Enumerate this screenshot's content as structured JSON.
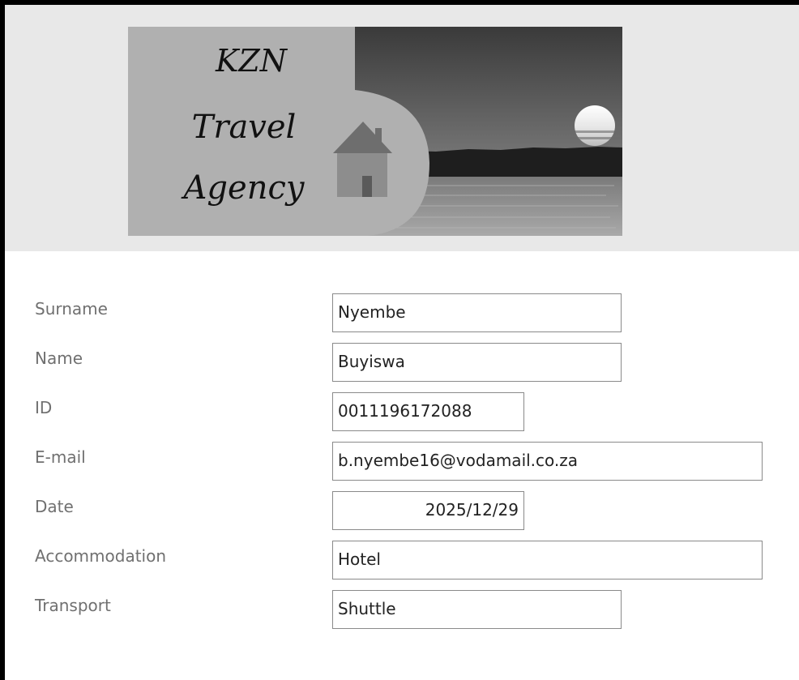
{
  "logo": {
    "name": "KZN Travel Agency",
    "lines": [
      "KZN",
      "Travel",
      "Agency"
    ],
    "icons": [
      "house-icon",
      "sunset-scene-icon"
    ]
  },
  "form": {
    "fields": [
      {
        "key": "surname",
        "label": "Surname",
        "value": "Nyembe"
      },
      {
        "key": "name",
        "label": "Name",
        "value": "Buyiswa"
      },
      {
        "key": "id",
        "label": "ID",
        "value": "0011196172088"
      },
      {
        "key": "email",
        "label": "E-mail",
        "value": "b.nyembe16@vodamail.co.za"
      },
      {
        "key": "date",
        "label": "Date",
        "value": "2025/12/29"
      },
      {
        "key": "accommodation",
        "label": "Accommodation",
        "value": "Hotel"
      },
      {
        "key": "transport",
        "label": "Transport",
        "value": "Shuttle"
      }
    ]
  },
  "colors": {
    "header_background": "#e8e8e8",
    "label_text": "#707070",
    "field_border": "#8a8a8a",
    "window_border": "#000000"
  }
}
